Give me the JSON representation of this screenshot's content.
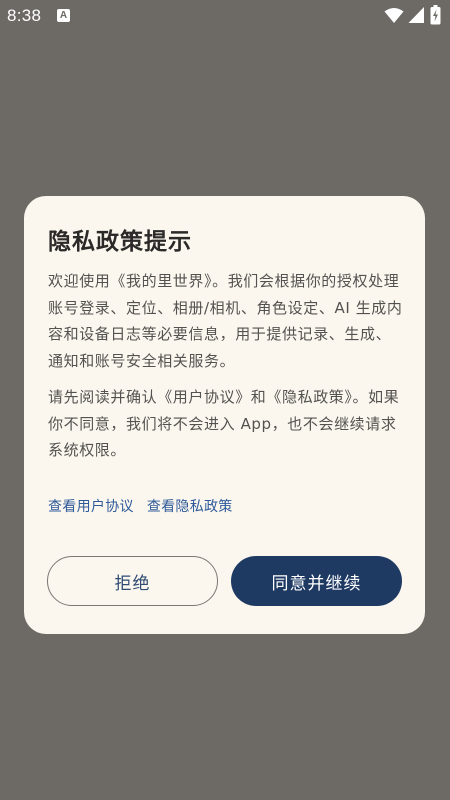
{
  "status_bar": {
    "time": "8:38",
    "notification_glyph": "A",
    "icons": [
      "wifi-icon",
      "signal-icon",
      "battery-charging-icon"
    ]
  },
  "dialog": {
    "title": "隐私政策提示",
    "paragraph_1": "欢迎使用《我的里世界》。我们会根据你的授权处理账号登录、定位、相册/相机、角色设定、AI 生成内容和设备日志等必要信息，用于提供记录、生成、通知和账号安全相关服务。",
    "paragraph_2": "请先阅读并确认《用户协议》和《隐私政策》。如果你不同意，我们将不会进入 App，也不会继续请求系统权限。",
    "links": {
      "user_agreement": "查看用户协议",
      "privacy_policy": "查看隐私政策"
    },
    "buttons": {
      "reject": "拒绝",
      "accept": "同意并继续"
    }
  },
  "colors": {
    "backdrop": "#6d6a66",
    "card": "#fbf7ef",
    "primary": "#1e3a63",
    "link": "#2f5a9a",
    "text": "#545250",
    "title": "#2b2a29"
  }
}
